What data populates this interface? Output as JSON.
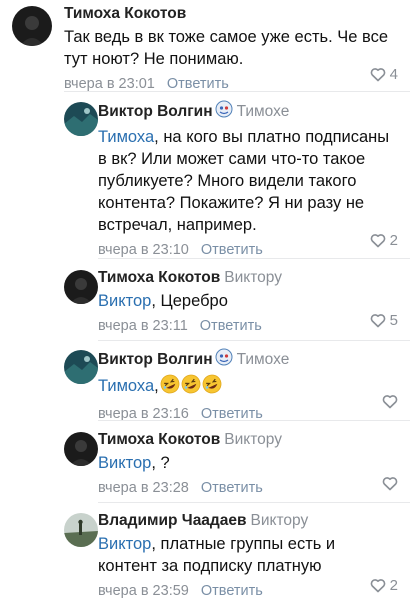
{
  "comments": [
    {
      "author": "Тимоха Кокотов",
      "reply_to": "",
      "mention": "",
      "text": "Так ведь в вк тоже самое уже есть. Че все тут ноют? Не понимаю.",
      "time": "вчера в 23:01",
      "reply_label": "Ответить",
      "likes": "4"
    },
    {
      "author": "Виктор Волгин",
      "reply_to": "Тимохе",
      "mention": "Тимоха",
      "text": ", на кого вы платно подписаны в вк? Или может сами что-то такое публикуете? Много видели такого контента? Покажите? Я ни разу не встречал, например.",
      "time": "вчера в 23:10",
      "reply_label": "Ответить",
      "likes": "2"
    },
    {
      "author": "Тимоха Кокотов",
      "reply_to": "Виктору",
      "mention": "Виктор",
      "text": ", Церебро",
      "time": "вчера в 23:11",
      "reply_label": "Ответить",
      "likes": "5"
    },
    {
      "author": "Виктор Волгин",
      "reply_to": "Тимохе",
      "mention": "Тимоха",
      "text": ",",
      "emojis": [
        "rofl-emoji",
        "rofl-emoji",
        "rofl-emoji"
      ],
      "time": "вчера в 23:16",
      "reply_label": "Ответить",
      "likes": ""
    },
    {
      "author": "Тимоха Кокотов",
      "reply_to": "Виктору",
      "mention": "Виктор",
      "text": ", ?",
      "time": "вчера в 23:28",
      "reply_label": "Ответить",
      "likes": ""
    },
    {
      "author": "Владимир Чаадаев",
      "reply_to": "Виктору",
      "mention": "Виктор",
      "text": ", платные группы есть и контент за подписку платную",
      "time": "вчера в 23:59",
      "reply_label": "Ответить",
      "likes": "2"
    }
  ],
  "colors": {
    "mention": "#2a6fb0",
    "reply_button": "#7a8fa6",
    "meta": "#8a8f96"
  }
}
